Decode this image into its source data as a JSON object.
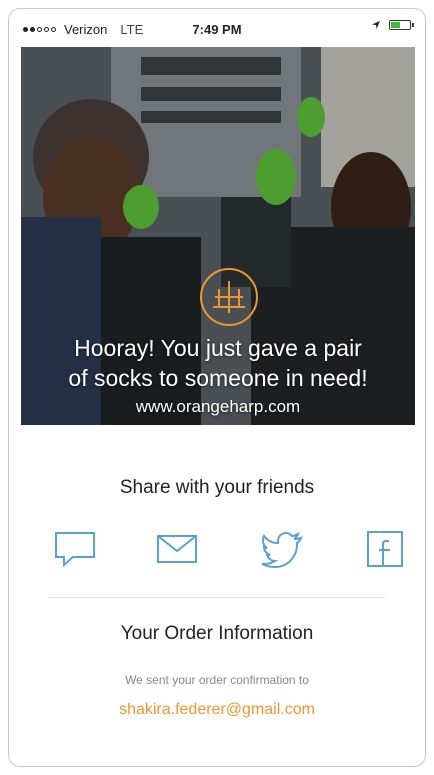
{
  "status_bar": {
    "carrier": "Verizon",
    "network": "LTE",
    "time": "7:49 PM",
    "signal_bars_filled": 2,
    "signal_bars_total": 5,
    "battery_level": 0.45
  },
  "hero": {
    "headline_line1": "Hooray! You just gave a pair",
    "headline_line2": "of socks to someone in need!",
    "url": "www.orangeharp.com",
    "logo_color": "#f0962e"
  },
  "share": {
    "title": "Share with your friends",
    "icon_color": "#5a9fd6",
    "buttons": [
      {
        "icon": "message-icon"
      },
      {
        "icon": "email-icon"
      },
      {
        "icon": "twitter-icon"
      },
      {
        "icon": "facebook-icon"
      }
    ]
  },
  "order": {
    "title": "Your Order Information",
    "note": "We sent your order confirmation to",
    "email": "shakira.federer@gmail.com",
    "email_color": "#f0962e"
  }
}
